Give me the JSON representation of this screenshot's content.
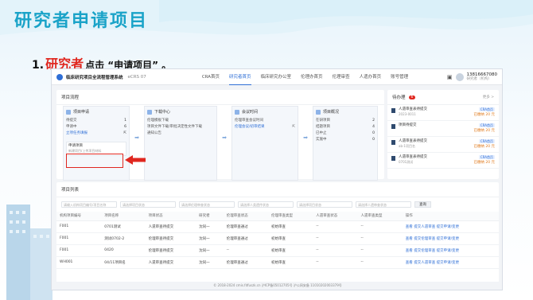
{
  "slide": {
    "title": "研究者申请项目",
    "step_num": "1.",
    "step_hl": "研究者",
    "step_rest": "点击 “申请项目” 。"
  },
  "app": {
    "name": "临床研究项目全流程管理系统",
    "version": "eCRS 07",
    "nav": [
      "CRA首页",
      "研究者首页",
      "临床研究办公室",
      "伦理办首页",
      "伦理审查",
      "人遗办首页",
      "账号管理"
    ],
    "active_nav": 1,
    "user_name": "13816667080",
    "user_role": "研究者（机构）"
  },
  "flow": {
    "title": "项目流程",
    "cards": [
      {
        "title": "项目申请",
        "rows": [
          {
            "k": "待提交",
            "v": "1"
          },
          {
            "k": "申请中",
            "v": "6"
          },
          {
            "k": "立项任务填报",
            "v": ""
          }
        ],
        "apply_title": "申请项目",
        "apply_sub": "新建项目/上传项目材料"
      },
      {
        "title": "下载中心",
        "items": [
          "伦理模板下载",
          "项目文件下载/审批决定性文件下载",
          "通知公告"
        ]
      },
      {
        "title": "会议时间",
        "items": [
          "伦理审查会议时间",
          "伦理会议/初审结果"
        ]
      },
      {
        "title": "项目概况",
        "rows": [
          {
            "k": "在研项目",
            "v": "2"
          },
          {
            "k": "结题项目",
            "v": "4"
          },
          {
            "k": "已中止",
            "v": "0"
          },
          {
            "k": "实施中",
            "v": "0"
          }
        ]
      }
    ]
  },
  "todo": {
    "title": "待办理",
    "count": "6",
    "more": "更多 >",
    "items": [
      {
        "t": "人遗审查表待提交",
        "s": "2023-0011",
        "tag": "CRA首页",
        "amt": "已缴纳 20 元"
      },
      {
        "t": "项目待提交",
        "s": "",
        "tag": "CRA首页",
        "amt": "已缴纳 20 元"
      },
      {
        "t": "人遗审查表待提交",
        "s": "ab-1项目名",
        "tag": "CRA首页",
        "amt": "已缴纳 20 元"
      },
      {
        "t": "人遗审查表待提交",
        "s": "0701测试",
        "tag": "CRA首页",
        "amt": "已缴纳 20 元"
      }
    ]
  },
  "list": {
    "title": "项目列表",
    "filters": [
      "请输入机构项目编号/项目名称",
      "请选择项目状态",
      "请选择伦理审查状态",
      "请选择人类遗传状态",
      "请选择项目状态",
      "请选择人遗审查状态"
    ],
    "query": "查询",
    "headers": [
      "机构项目编号",
      "项目名称",
      "项目状态",
      "研究者",
      "伦理审查状态",
      "伦理审查类型",
      "人遗审查状态",
      "人遗审查类型",
      "操作"
    ],
    "rows": [
      [
        "F001",
        "0701测试",
        "人遗审查待提交",
        "沈同一",
        "伦理审查通过",
        "初始审查",
        "--",
        "--",
        "查看  提交人遗审查  提交申请/变更"
      ],
      [
        "F001",
        "测试0702-2",
        "伦理审查待提交",
        "沈同一",
        "伦理审查通过",
        "初始审查",
        "--",
        "--",
        "查看  提交伦理审查  提交申请/变更"
      ],
      [
        "F001",
        "0420",
        "伦理审查待提交",
        "沈同一",
        "--",
        "初始审查",
        "--",
        "--",
        "查看  提交伦理审查  提交申请/变更"
      ],
      [
        "WH001",
        "04/11项目名",
        "人遗审查待提交",
        "沈同一",
        "伦理审查通过",
        "初始审查",
        "--",
        "--",
        "查看  提交人遗审查  提交申请/变更"
      ]
    ]
  },
  "footer": "© 2018-2024 cmis.fdfuszk.cn 沪ICP备05012705号 沪公网安备 11010202003379号"
}
